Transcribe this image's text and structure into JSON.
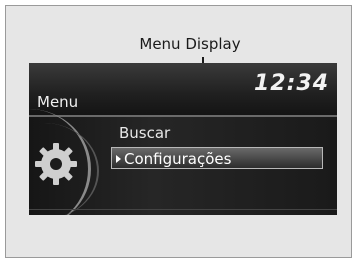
{
  "callout": {
    "label": "Menu Display"
  },
  "display": {
    "clock": "12:34",
    "title": "Menu",
    "items": [
      {
        "label": "Buscar",
        "selected": false
      },
      {
        "label": "Configurações",
        "selected": true
      }
    ],
    "icon": "gear-icon"
  },
  "colors": {
    "screen_background": "#0b0b0b",
    "text": "#f0f0f0",
    "selection_fill": "#6a6a6a",
    "selection_border": "#b8b8b8"
  }
}
